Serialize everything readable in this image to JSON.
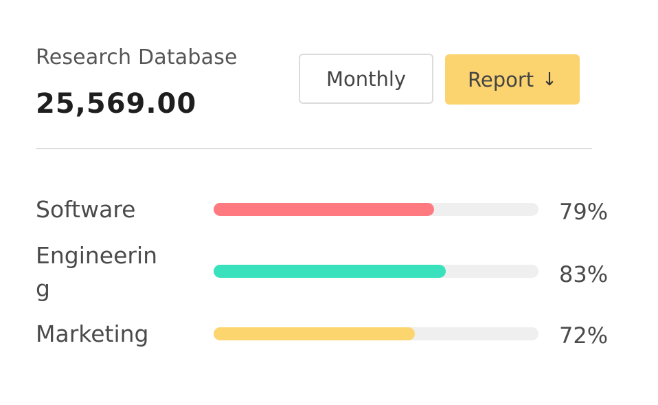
{
  "header": {
    "title": "Research Database",
    "amount": "25,569.00"
  },
  "buttons": {
    "monthly_label": "Monthly",
    "report_label": "Report",
    "report_icon": "arrow-down-icon"
  },
  "categories": [
    {
      "label": "Software",
      "percent_text": "79%",
      "percent": 79,
      "color": "#ff7a80"
    },
    {
      "label": "Engineering",
      "percent_text": "83%",
      "percent": 83,
      "color": "#39e2bd"
    },
    {
      "label": "Marketing",
      "percent_text": "72%",
      "percent": 72,
      "color": "#fdd56f"
    }
  ],
  "colors": {
    "accent": "#fcd46f",
    "track": "#efefef"
  }
}
